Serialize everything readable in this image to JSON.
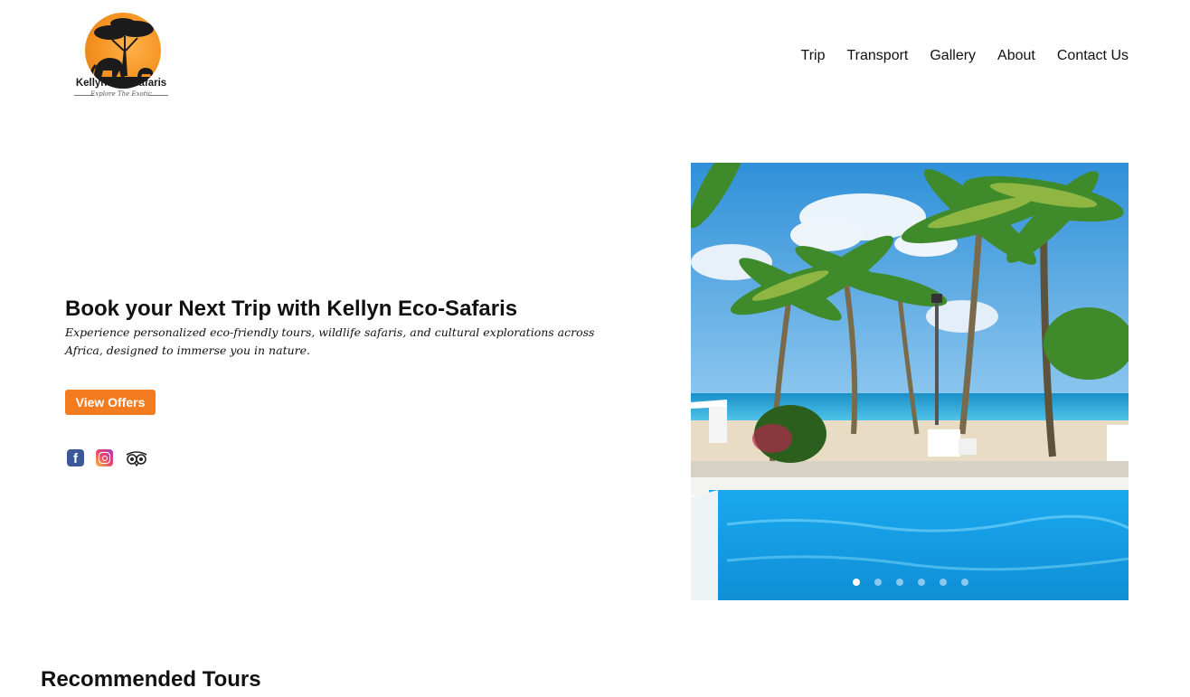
{
  "header": {
    "logo": {
      "brand": "Kellyn Eco Safaris",
      "tagline": "Explore The Exotic"
    },
    "nav": [
      {
        "label": "Trip"
      },
      {
        "label": "Transport"
      },
      {
        "label": "Gallery"
      },
      {
        "label": "About"
      },
      {
        "label": "Contact Us"
      }
    ]
  },
  "hero": {
    "title": "Book your Next Trip with Kellyn Eco-Safaris",
    "subtitle": "Experience personalized eco-friendly tours, wildlife safaris, and cultural explorations across Africa, designed to immerse you in nature.",
    "cta_label": "View Offers",
    "social_icons": [
      "facebook-icon",
      "instagram-icon",
      "tripadvisor-icon"
    ],
    "fb_glyph": "f"
  },
  "slider": {
    "slide_count": 6,
    "active_index": 0,
    "image_subject": "beach resort with palm trees and swimming pool"
  },
  "recommended": {
    "title": "Recommended Tours"
  },
  "colors": {
    "accent": "#f47c20",
    "logo_orange": "#f59322",
    "pool_blue": "#19a6e8",
    "sky_blue": "#3da2e0"
  }
}
